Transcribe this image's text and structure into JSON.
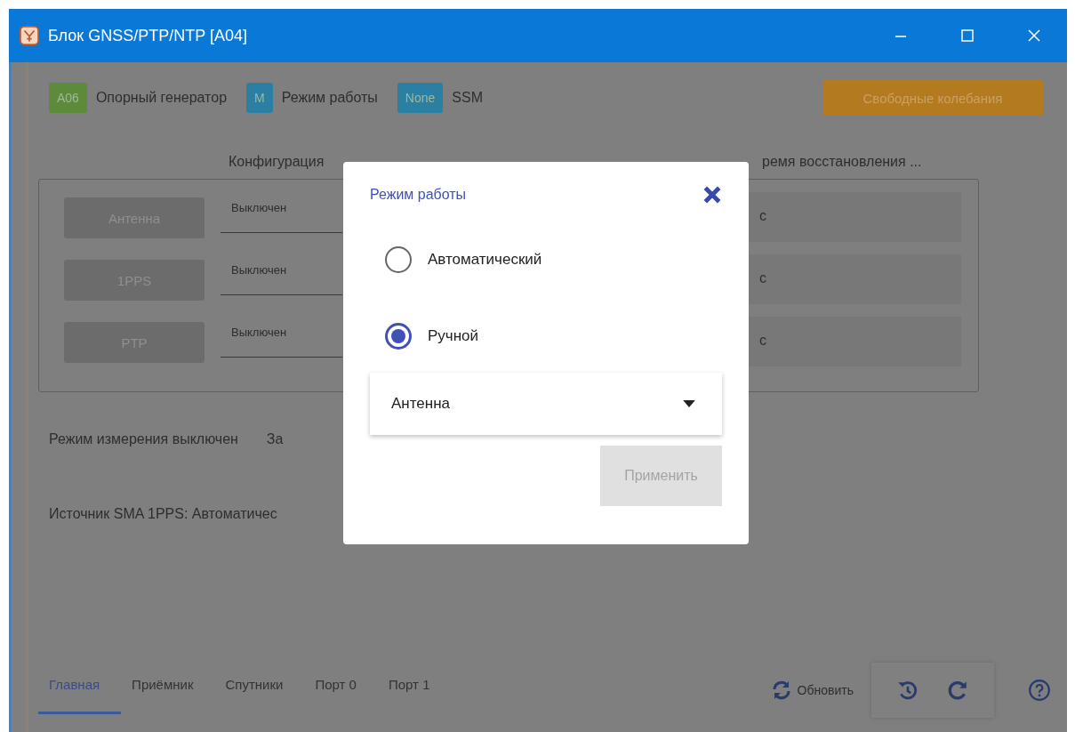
{
  "window": {
    "title": "Блок GNSS/PTP/NTP [A04]"
  },
  "status_tags": [
    {
      "badge": "A06",
      "label": "Опорный генератор",
      "color": "#5e8a3c"
    },
    {
      "badge": "M",
      "label": "Режим работы",
      "color": "#2b7fa3"
    },
    {
      "badge": "None",
      "label": "SSM",
      "color": "#2b7fa3"
    }
  ],
  "state_button": {
    "label": "Свободные колебания"
  },
  "config": {
    "left_heading": "Конфигурация",
    "right_heading": "ремя восстановления ...",
    "rows": [
      {
        "source": "Антенна",
        "value": "Выключен",
        "recovery": "с"
      },
      {
        "source": "1PPS",
        "value": "Выключен",
        "recovery": "с"
      },
      {
        "source": "PTP",
        "value": "Выключен",
        "recovery": "с"
      }
    ]
  },
  "info": [
    {
      "texts": [
        "Режим измерения выключен",
        "За"
      ]
    },
    {
      "texts": [
        "Источник SMA 1PPS: Автоматичес"
      ]
    }
  ],
  "dialog": {
    "title": "Режим работы",
    "options": [
      {
        "label": "Автоматический",
        "selected": false
      },
      {
        "label": "Ручной",
        "selected": true
      }
    ],
    "select": {
      "value": "Антенна"
    },
    "apply": {
      "label": "Применить",
      "disabled": true
    }
  },
  "nav_tabs": [
    {
      "label": "Главная",
      "selected": true
    },
    {
      "label": "Приёмник",
      "selected": false
    },
    {
      "label": "Спутники",
      "selected": false
    },
    {
      "label": "Порт 0",
      "selected": false
    },
    {
      "label": "Порт 1",
      "selected": false
    }
  ],
  "refresh": {
    "label": "Обновить"
  }
}
